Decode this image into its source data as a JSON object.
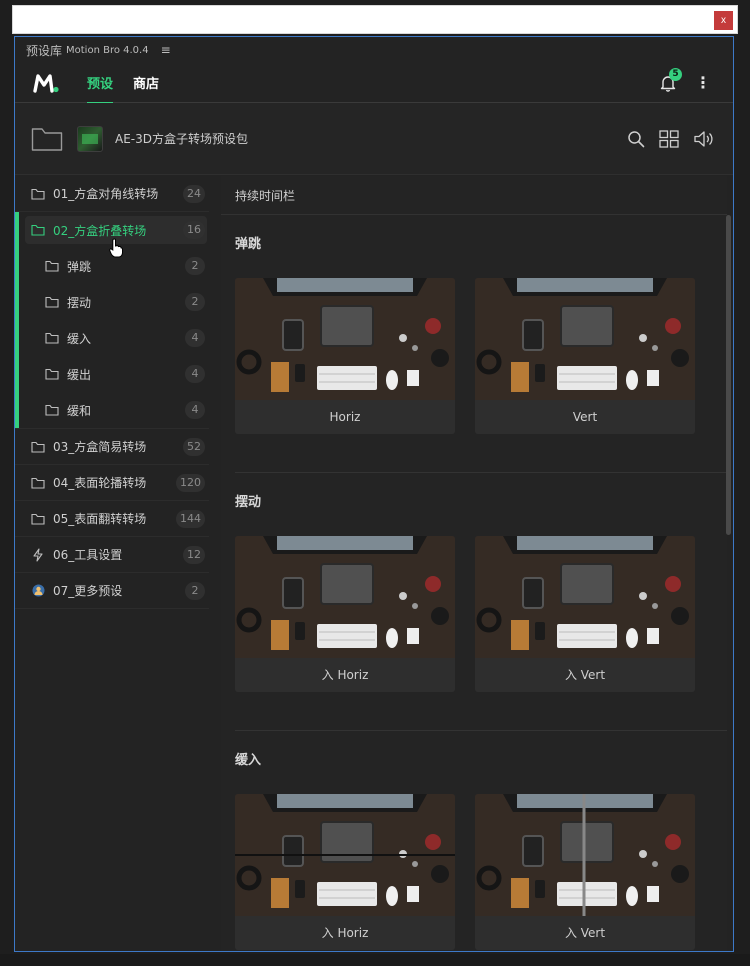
{
  "window": {
    "close_label": "x"
  },
  "panel": {
    "title": "预设库",
    "app_version": "Motion Bro 4.0.4",
    "menu_glyph": "≡"
  },
  "nav": {
    "tabs": [
      {
        "label": "预设",
        "active": true
      },
      {
        "label": "商店",
        "active": false
      }
    ],
    "notification_count": "5",
    "more_glyph": "⋮",
    "accent": "#35d07f"
  },
  "pathbar": {
    "pack_name": "AE-3D方盒子转场预设包"
  },
  "sidebar": {
    "items": [
      {
        "label": "01_方盒对角线转场",
        "count": "24",
        "icon": "folder-icon"
      },
      {
        "label": "02_方盒折叠转场",
        "count": "16",
        "icon": "folder-icon",
        "active": true,
        "children": [
          {
            "label": "弹跳",
            "count": "2"
          },
          {
            "label": "摆动",
            "count": "2"
          },
          {
            "label": "缓入",
            "count": "4"
          },
          {
            "label": "缓出",
            "count": "4"
          },
          {
            "label": "缓和",
            "count": "4"
          }
        ]
      },
      {
        "label": "03_方盒简易转场",
        "count": "52",
        "icon": "folder-icon"
      },
      {
        "label": "04_表面轮播转场",
        "count": "120",
        "icon": "folder-icon"
      },
      {
        "label": "05_表面翻转转场",
        "count": "144",
        "icon": "folder-icon"
      },
      {
        "label": "06_工具设置",
        "count": "12",
        "icon": "lightning-icon"
      },
      {
        "label": "07_更多预设",
        "count": "2",
        "icon": "avatar-icon"
      }
    ]
  },
  "content": {
    "timeline_label": "持续时间栏",
    "sections": [
      {
        "title": "弹跳",
        "cards": [
          {
            "label": "Horiz"
          },
          {
            "label": "Vert"
          }
        ]
      },
      {
        "title": "摆动",
        "cards": [
          {
            "label": "入 Horiz"
          },
          {
            "label": "入 Vert"
          }
        ]
      },
      {
        "title": "缓入",
        "cards": [
          {
            "label": "入 Horiz"
          },
          {
            "label": "入 Vert"
          }
        ]
      }
    ]
  }
}
